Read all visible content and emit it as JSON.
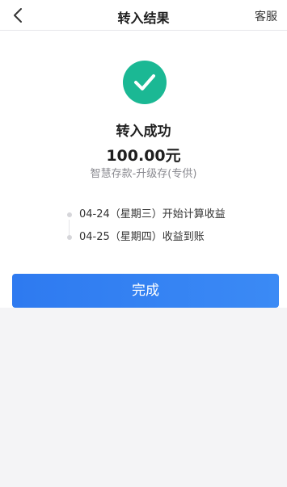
{
  "navbar": {
    "title": "转入结果",
    "right_action": "客服"
  },
  "result": {
    "status": "转入成功",
    "amount": "100.00元",
    "product": "智慧存款-升级存(专供)"
  },
  "timeline": [
    {
      "text": "04-24（星期三）开始计算收益"
    },
    {
      "text": "04-25（星期四）收益到账"
    }
  ],
  "actions": {
    "done_label": "完成"
  },
  "colors": {
    "success": "#1bb894",
    "primary": "#2e7af0"
  }
}
